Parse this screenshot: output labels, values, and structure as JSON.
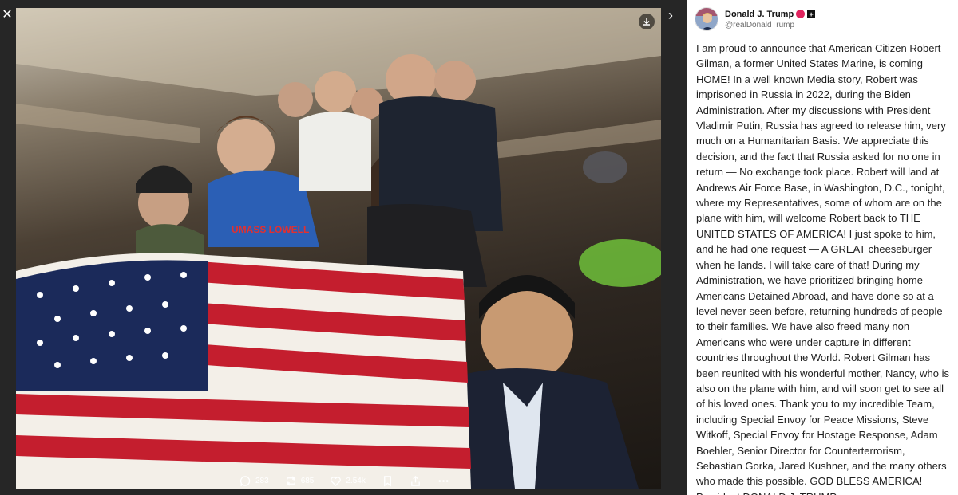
{
  "viewer": {
    "close_icon": "close-icon",
    "expand_icon": "chevron-right-icon",
    "download_icon": "download-icon"
  },
  "actions": [
    {
      "icon": "reply-icon",
      "count": "283"
    },
    {
      "icon": "retruth-icon",
      "count": "685"
    },
    {
      "icon": "like-icon",
      "count": "2.54k"
    },
    {
      "icon": "bookmark-icon",
      "count": ""
    },
    {
      "icon": "share-icon",
      "count": ""
    },
    {
      "icon": "more-icon",
      "count": ""
    }
  ],
  "author": {
    "display_name": "Donald J. Trump",
    "handle": "@realDonaldTrump",
    "verified_color": "#e0245e"
  },
  "post": {
    "text": "I am proud to announce that American Citizen Robert Gilman, a former United States Marine, is coming HOME! In a well known Media story, Robert was imprisoned in Russia in 2022, during the Biden Administration. After my discussions with President Vladimir Putin, Russia has agreed to release him, very much on a Humanitarian Basis. We appreciate this decision, and the fact that Russia asked for no one in return — No exchange took place. Robert will land at Andrews Air Force Base, in Washington, D.C., tonight, where my Representatives, some of whom are on the plane with him, will welcome Robert back to THE UNITED STATES OF AMERICA! I just spoke to him, and he had one request — A GREAT cheeseburger when he lands. I will take care of that! During my Administration, we have prioritized bringing home Americans Detained Abroad, and have done so at a level never seen before, returning hundreds of people to their families. We have also freed many non Americans who were under capture in different countries throughout the World. Robert Gilman has been reunited with his wonderful mother, Nancy, who is also on the plane with him, and will soon get to see all of his loved ones. Thank you to my incredible Team, including Special Envoy for Peace Missions, Steve Witkoff, Special Envoy for Hostage Response, Adam Boehler, Senior Director for Counterterrorism, Sebastian Gorka, Jared Kushner, and the many others who made this possible. GOD BLESS AMERICA! President DONALD J. TRUMP"
  },
  "photo": {
    "shirt_text": "UMASS LOWELL"
  }
}
